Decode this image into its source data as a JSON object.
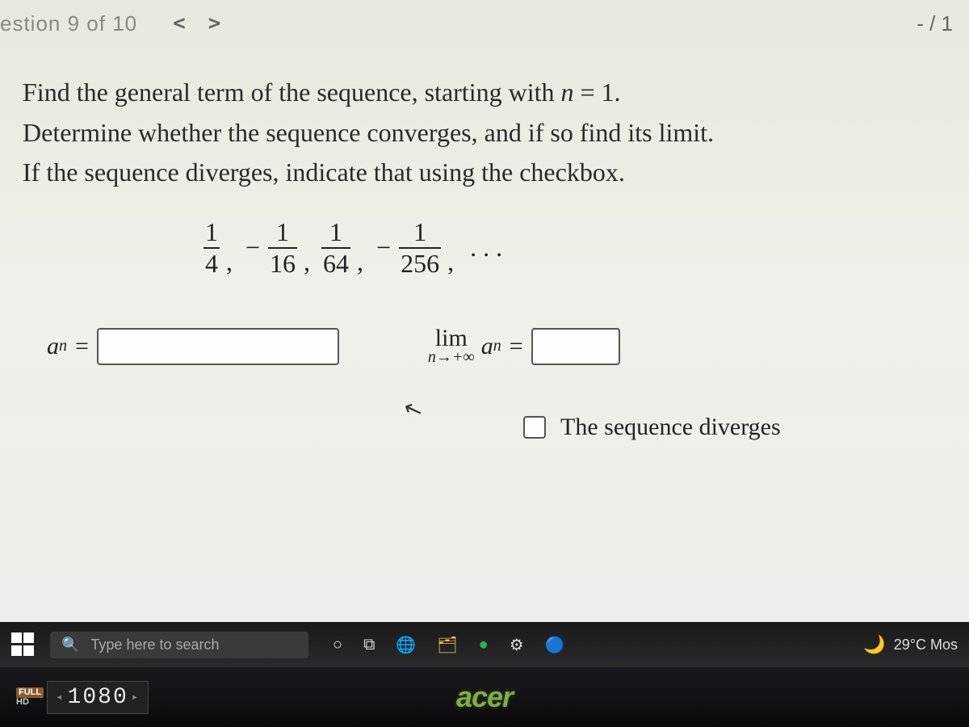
{
  "header": {
    "question_counter": "estion 9 of 10",
    "score": "- / 1"
  },
  "prompt": {
    "line1_prefix": "Find the general term of the sequence, starting with ",
    "line1_var": "n",
    "line1_suffix": " = 1.",
    "line2": "Determine whether the sequence converges, and if so find its limit.",
    "line3": "If the sequence diverges, indicate that using the checkbox."
  },
  "sequence": {
    "terms": [
      {
        "sign": "",
        "num": "1",
        "den": "4"
      },
      {
        "sign": "−",
        "num": "1",
        "den": "16"
      },
      {
        "sign": "",
        "num": "1",
        "den": "64"
      },
      {
        "sign": "−",
        "num": "1",
        "den": "256"
      }
    ],
    "trailing": ". . ."
  },
  "answers": {
    "an_label_base": "a",
    "an_label_sub": "n",
    "eq": "=",
    "lim_word": "lim",
    "lim_below": "n→+∞",
    "an_value": "",
    "lim_value": ""
  },
  "diverge": {
    "label": "The sequence diverges",
    "checked": false
  },
  "taskbar": {
    "search_placeholder": "Type here to search",
    "weather": "29°C Mos"
  },
  "bezel": {
    "full": "FULL",
    "hd": "HD",
    "resolution": "1080",
    "brand": "acer"
  }
}
